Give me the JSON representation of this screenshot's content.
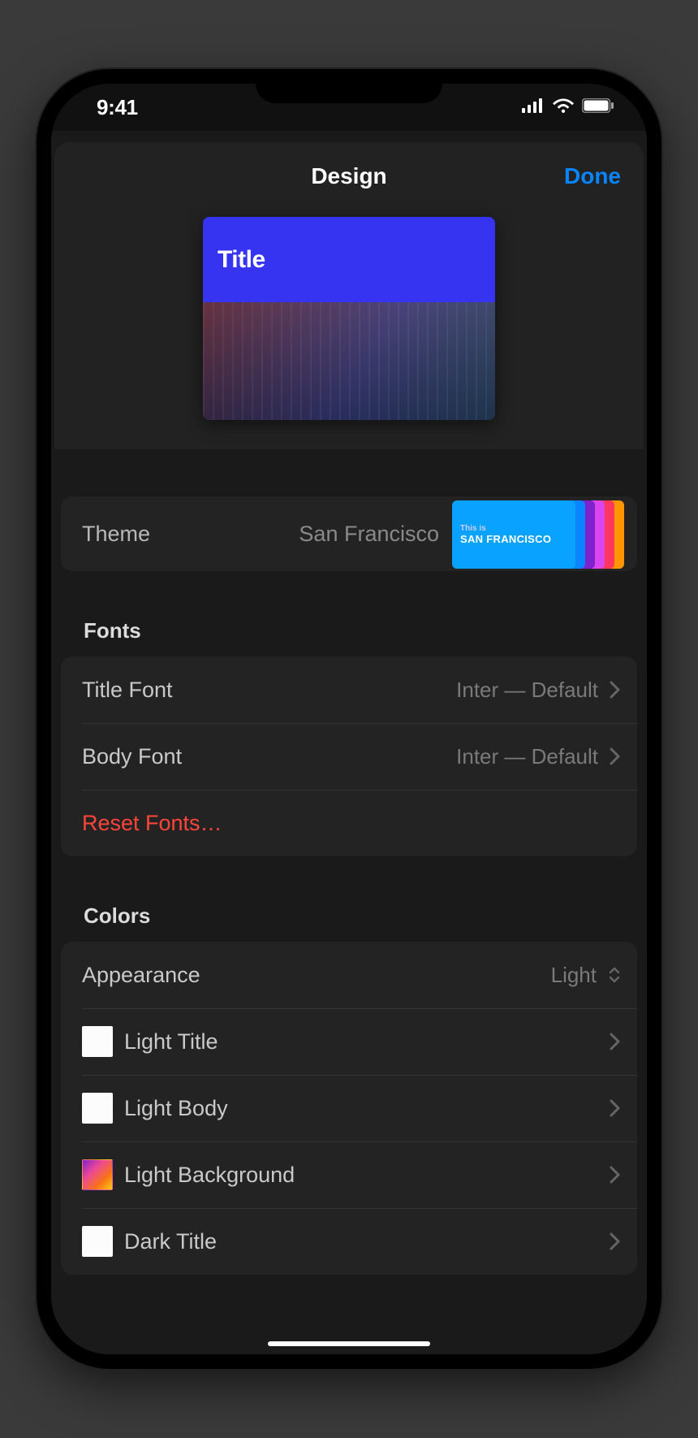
{
  "statusBar": {
    "time": "9:41"
  },
  "header": {
    "title": "Design",
    "done": "Done"
  },
  "preview": {
    "titleBand": "Title"
  },
  "theme": {
    "label": "Theme",
    "value": "San Francisco",
    "thumb": {
      "line1": "This is",
      "line2": "SAN FRANCISCO"
    }
  },
  "fonts": {
    "heading": "Fonts",
    "title": {
      "label": "Title Font",
      "value": "Inter  — Default"
    },
    "body": {
      "label": "Body Font",
      "value": "Inter  — Default"
    },
    "reset": "Reset Fonts…"
  },
  "colors": {
    "heading": "Colors",
    "appearance": {
      "label": "Appearance",
      "value": "Light"
    },
    "items": [
      {
        "label": "Light Title",
        "swatch": "white"
      },
      {
        "label": "Light Body",
        "swatch": "white"
      },
      {
        "label": "Light Background",
        "swatch": "gradient"
      },
      {
        "label": "Dark Title",
        "swatch": "white"
      }
    ]
  }
}
